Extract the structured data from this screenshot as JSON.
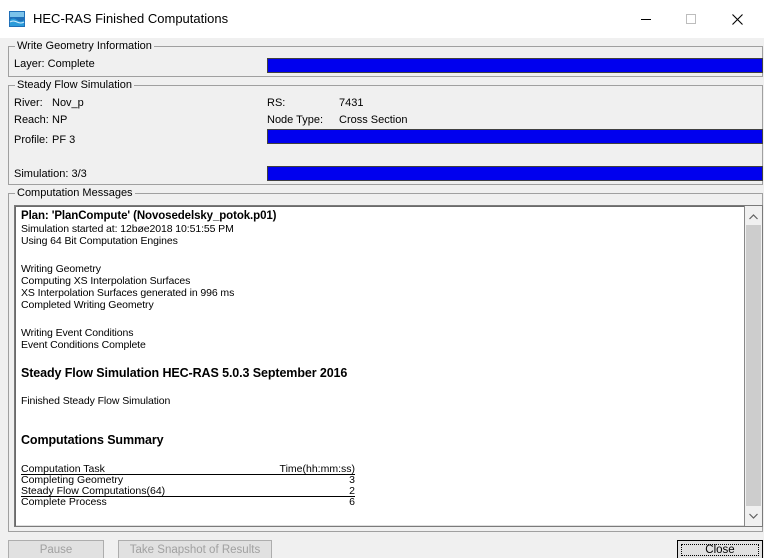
{
  "window": {
    "title": "HEC-RAS Finished Computations",
    "controls": {
      "minimize": "—",
      "maximize": "☐",
      "close": "✕"
    }
  },
  "write_geometry": {
    "legend": "Write Geometry Information",
    "layer_label": "Layer: Complete",
    "progress": 1.0
  },
  "steady_flow": {
    "legend": "Steady Flow Simulation",
    "river_label": "River:",
    "river_value": "Nov_p",
    "reach_label": "Reach:",
    "reach_value": "NP",
    "rs_label": "RS:",
    "rs_value": "7431",
    "node_type_label": "Node Type:",
    "node_type_value": "Cross Section",
    "profile_label": "Profile:",
    "profile_value": "PF 3",
    "profile_progress": 1.0,
    "simulation_label": "Simulation: 3/3",
    "simulation_progress": 1.0
  },
  "messages": {
    "legend": "Computation Messages",
    "lines": [
      "Plan: 'PlanCompute' (Novosedelsky_potok.p01)",
      "Simulation started at: 12bøe2018 10:51:55 PM",
      "Using 64 Bit Computation Engines",
      "Writing Geometry",
      "Computing XS Interpolation Surfaces",
      "XS Interpolation Surfaces generated in 996 ms",
      "Completed Writing Geometry",
      "Writing Event Conditions",
      "Event Conditions Complete",
      "Steady Flow Simulation HEC-RAS 5.0.3 September 2016",
      "Finished Steady Flow Simulation",
      "Computations Summary"
    ],
    "summary": {
      "header_task": "Computation Task",
      "header_time": "Time(hh:mm:ss)",
      "rows": [
        {
          "task": "Completing Geometry",
          "time": "3"
        },
        {
          "task": "Steady Flow Computations(64)",
          "time": "2"
        },
        {
          "task": "Complete Process",
          "time": "6"
        }
      ]
    }
  },
  "buttons": {
    "pause": "Pause",
    "snapshot": "Take Snapshot of Results",
    "close": "Close"
  },
  "colors": {
    "progress": "#0000ee",
    "window_bg": "#f0f0f0"
  }
}
